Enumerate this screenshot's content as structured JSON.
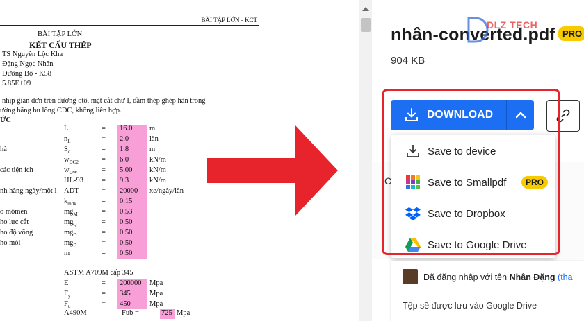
{
  "document": {
    "header_right": "BÀI TẬP LỚN - KCT",
    "title1": "BÀI TẬP LỚN",
    "title2": "KẾT CẤU THÉP",
    "lines": [
      "TS Nguyễn Lộc Kha",
      "Đặng Ngọc Nhân",
      "Đường Bộ - K58",
      "5.85E+09"
    ],
    "desc1": "nhịp giản đơn trên đường ôtô, mặt cắt chữ I, dầm thép ghép hàn trong",
    "desc2": "ường bằng bu lông CĐC, không liên hợp.",
    "section": "ỨC",
    "rows": [
      {
        "left": "",
        "sym": "L",
        "eq": "=",
        "val": "16.0",
        "unit": "m"
      },
      {
        "left": "",
        "sym": "nL",
        "eq": "=",
        "val": "2.0",
        "unit": "làn"
      },
      {
        "left": "hà",
        "sym": "Sd",
        "eq": "=",
        "val": "1.8",
        "unit": "m"
      },
      {
        "left": "",
        "sym": "wDC2",
        "eq": "=",
        "val": "6.0",
        "unit": "kN/m"
      },
      {
        "left": "các tiện ích",
        "sym": "wDW",
        "eq": "=",
        "val": "5.00",
        "unit": "kN/m"
      },
      {
        "left": "",
        "sym": "HL-93",
        "eq": "=",
        "val": "9.3",
        "unit": "kN/m"
      },
      {
        "left": "nh hàng ngày/một l",
        "sym": "ADT",
        "eq": "=",
        "val": "20000",
        "unit": "xe/ngày/làn"
      },
      {
        "left": "",
        "sym": "kmdk",
        "eq": "=",
        "val": "0.15",
        "unit": ""
      },
      {
        "left": "o mômen",
        "sym": "mgM",
        "eq": "=",
        "val": "0.53",
        "unit": ""
      },
      {
        "left": "ho lực cắt",
        "sym": "mgQ",
        "eq": "=",
        "val": "0.50",
        "unit": ""
      },
      {
        "left": "ho độ võng",
        "sym": "mgD",
        "eq": "=",
        "val": "0.50",
        "unit": ""
      },
      {
        "left": "ho mỏi",
        "sym": "mgF",
        "eq": "=",
        "val": "0.50",
        "unit": ""
      },
      {
        "left": "",
        "sym": "m",
        "eq": "=",
        "val": "0.50",
        "unit": ""
      }
    ],
    "steel": "ASTM A709M cấp 345",
    "rows2": [
      {
        "sym": "E",
        "eq": "=",
        "val": "200000",
        "unit": "Mpa"
      },
      {
        "sym": "Fy",
        "eq": "=",
        "val": "345",
        "unit": "Mpa"
      },
      {
        "sym": "Fu",
        "eq": "=",
        "val": "450",
        "unit": "Mpa"
      }
    ],
    "bolt": "A490M",
    "bolt_sym": "Fub =",
    "bolt_val": "725",
    "bolt_unit": "Mpa"
  },
  "panel": {
    "file_name": "nhân-converted.pdf",
    "file_size": "904 KB",
    "pro_badge": "PRO",
    "watermark": "DLZ TECH",
    "download_label": "DOWNLOAD",
    "side_letter": "C",
    "menu": [
      {
        "label": "Save to device",
        "icon": "download-icon"
      },
      {
        "label": "Save to Smallpdf",
        "icon": "smallpdf-icon",
        "badge": "PRO"
      },
      {
        "label": "Save to Dropbox",
        "icon": "dropbox-icon"
      },
      {
        "label": "Save to Google Drive",
        "icon": "google-drive-icon"
      }
    ],
    "toast": {
      "signed_in_prefix": "Đã đăng nhập với tên",
      "user_name": "Nhân Đặng",
      "link": "(tha",
      "saved_msg": "Tệp sẽ được lưu vào Google Drive"
    }
  },
  "colors": {
    "accent": "#1c6ff2",
    "highlight": "#f79fd6",
    "annotation_red": "#e7242b",
    "pro": "#f7cb00"
  }
}
